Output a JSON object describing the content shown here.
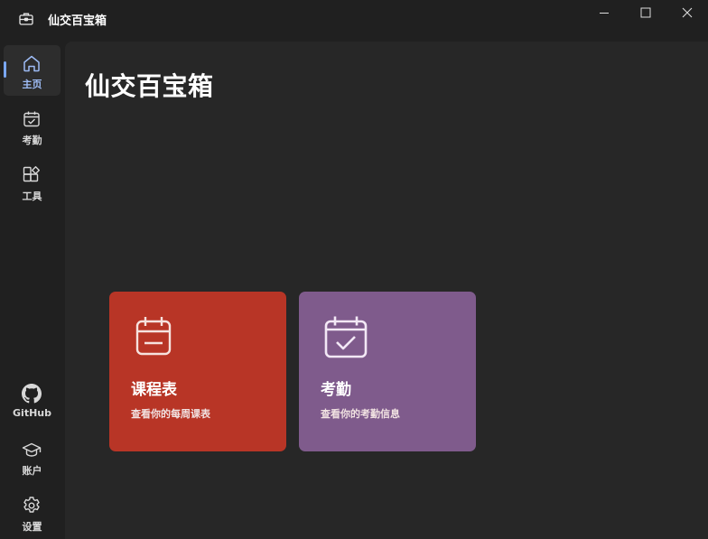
{
  "app": {
    "title": "仙交百宝箱"
  },
  "sidebar": {
    "items": [
      {
        "label": "主页",
        "icon": "home-icon",
        "active": true
      },
      {
        "label": "考勤",
        "icon": "calendar-check-icon"
      },
      {
        "label": "工具",
        "icon": "apps-icon"
      }
    ],
    "footer": [
      {
        "label": "GitHub",
        "icon": "github-icon"
      },
      {
        "label": "账户",
        "icon": "graduation-cap-icon"
      },
      {
        "label": "设置",
        "icon": "gear-icon"
      }
    ]
  },
  "main": {
    "title": "仙交百宝箱",
    "cards": [
      {
        "title": "课程表",
        "subtitle": "查看你的每周课表",
        "icon": "calendar-icon",
        "color": "#b83526"
      },
      {
        "title": "考勤",
        "subtitle": "查看你的考勤信息",
        "icon": "calendar-check-icon",
        "color": "#7f5b8c"
      }
    ]
  },
  "colors": {
    "window_bg": "#202020",
    "panel_bg": "#272727",
    "accent": "#7aa7f2"
  }
}
